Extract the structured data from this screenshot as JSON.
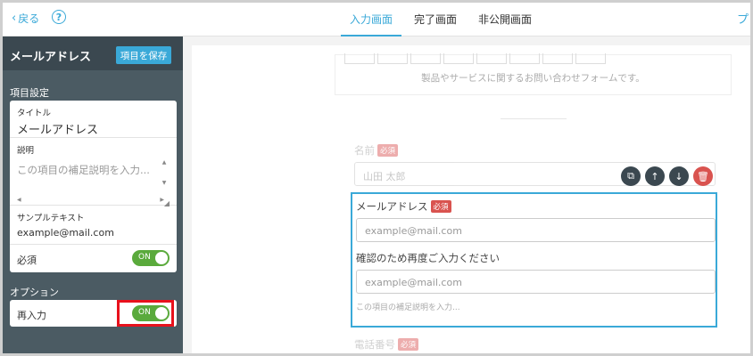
{
  "topbar": {
    "back_label": "戻る",
    "help_label": "?",
    "tabs": [
      "入力画面",
      "完了画面",
      "非公開画面"
    ],
    "right_label": "プ"
  },
  "sidebar": {
    "title": "メールアドレス",
    "save_label": "項目を保存",
    "settings_heading": "項目設定",
    "title_label": "タイトル",
    "title_value": "メールアドレス",
    "description_label": "説明",
    "description_placeholder": "この項目の補足説明を入力...",
    "sample_label": "サンプルテキスト",
    "sample_value": "example@mail.com",
    "required_label": "必須",
    "required_toggle": "ON",
    "options_heading": "オプション",
    "reenter_label": "再入力",
    "reenter_toggle": "ON"
  },
  "preview": {
    "form_description": "製品やサービスに関するお問い合わせフォームです。",
    "name_label": "名前",
    "required_badge": "必須",
    "name_placeholder": "山田 太郎",
    "email_label": "メールアドレス",
    "email_placeholder": "example@mail.com",
    "confirm_label": "確認のため再度ご入力ください",
    "confirm_placeholder": "example@mail.com",
    "hint": "この項目の補足説明を入力...",
    "phone_label": "電話番号"
  },
  "colors": {
    "accent": "#3aa9d8",
    "sidebar_bg": "#4b5b63",
    "toggle_on": "#5aaa3c",
    "required_badge": "#d9534f",
    "highlight": "#e8111c"
  }
}
